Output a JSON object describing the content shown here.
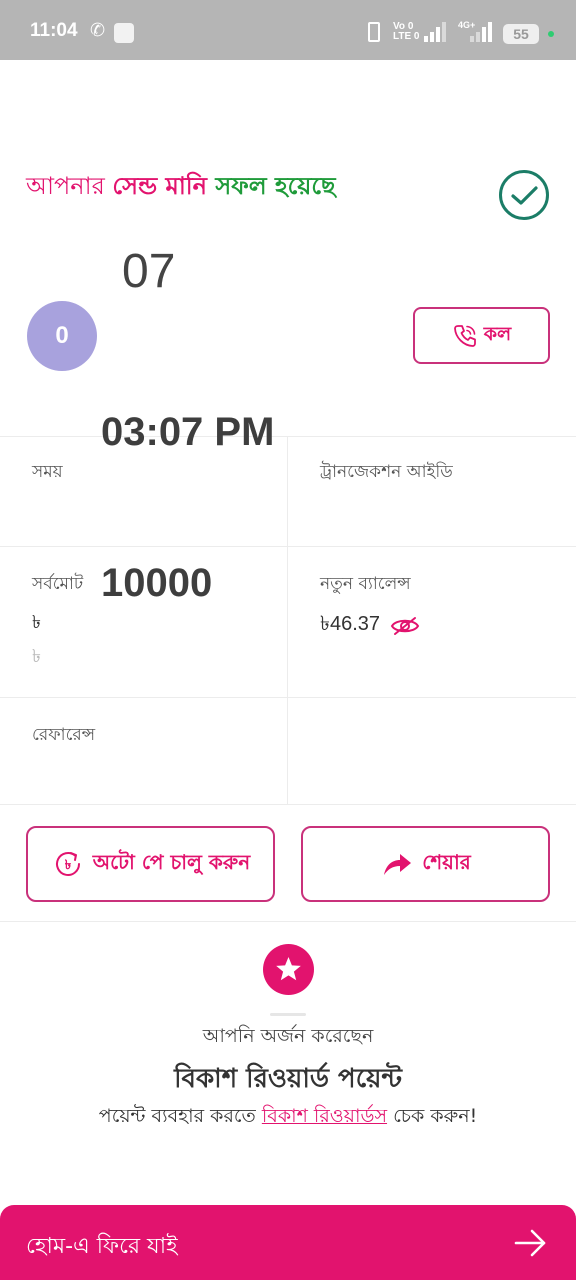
{
  "status_bar": {
    "time": "11:04",
    "volte_top": "Vo 0",
    "volte_bottom": "LTE 0",
    "network": "4G+",
    "battery": "55",
    "icons": [
      "phone-icon",
      "app-notification-icon",
      "vibrate-icon",
      "signal-icon",
      "battery-icon"
    ]
  },
  "header": {
    "success_prefix": "আপনার ",
    "success_action": "সেন্ড মানি",
    "success_suffix": " সফল হয়েছে",
    "success_icon": "check-circle-icon"
  },
  "recipient": {
    "number": "07",
    "avatar_letter": "0",
    "call_label": "কল",
    "call_icon": "phone-call-icon"
  },
  "details": {
    "time_value": "03:07 PM",
    "time_label": "সময়",
    "trxid_label": "ট্রানজেকশন আইডি",
    "total_label": "সর্বমোট",
    "total_value": "10000",
    "total_currency_symbol": "৳",
    "total_sub": "৳",
    "new_balance_label": "নতুন ব্যালেন্স",
    "new_balance_value": "৳46.37",
    "reference_label": "রেফারেন্স"
  },
  "actions": {
    "autopay_label": "অটো পে চালু করুন",
    "autopay_icon": "autopay-cycle-icon",
    "share_label": "শেয়ার",
    "share_icon": "share-arrow-icon"
  },
  "rewards": {
    "earned_text": "আপনি অর্জন করেছেন",
    "points_title": "বিকাশ রিওয়ার্ড পয়েন্ট",
    "use_prefix": "পয়েন্ট ব্যবহার করতে ",
    "link_text": "বিকাশ রিওয়ার্ডস",
    "use_suffix": " চেক করুন!",
    "icon": "star-icon"
  },
  "bottom": {
    "home_label": "হোম-এ ফিরে যাই",
    "icon": "arrow-right-icon"
  },
  "colors": {
    "brand": "#e2136e",
    "success": "#1f9b3a",
    "check": "#1b7d67",
    "avatar": "#a8a2dd",
    "status_bar": "#b5b5b5"
  }
}
